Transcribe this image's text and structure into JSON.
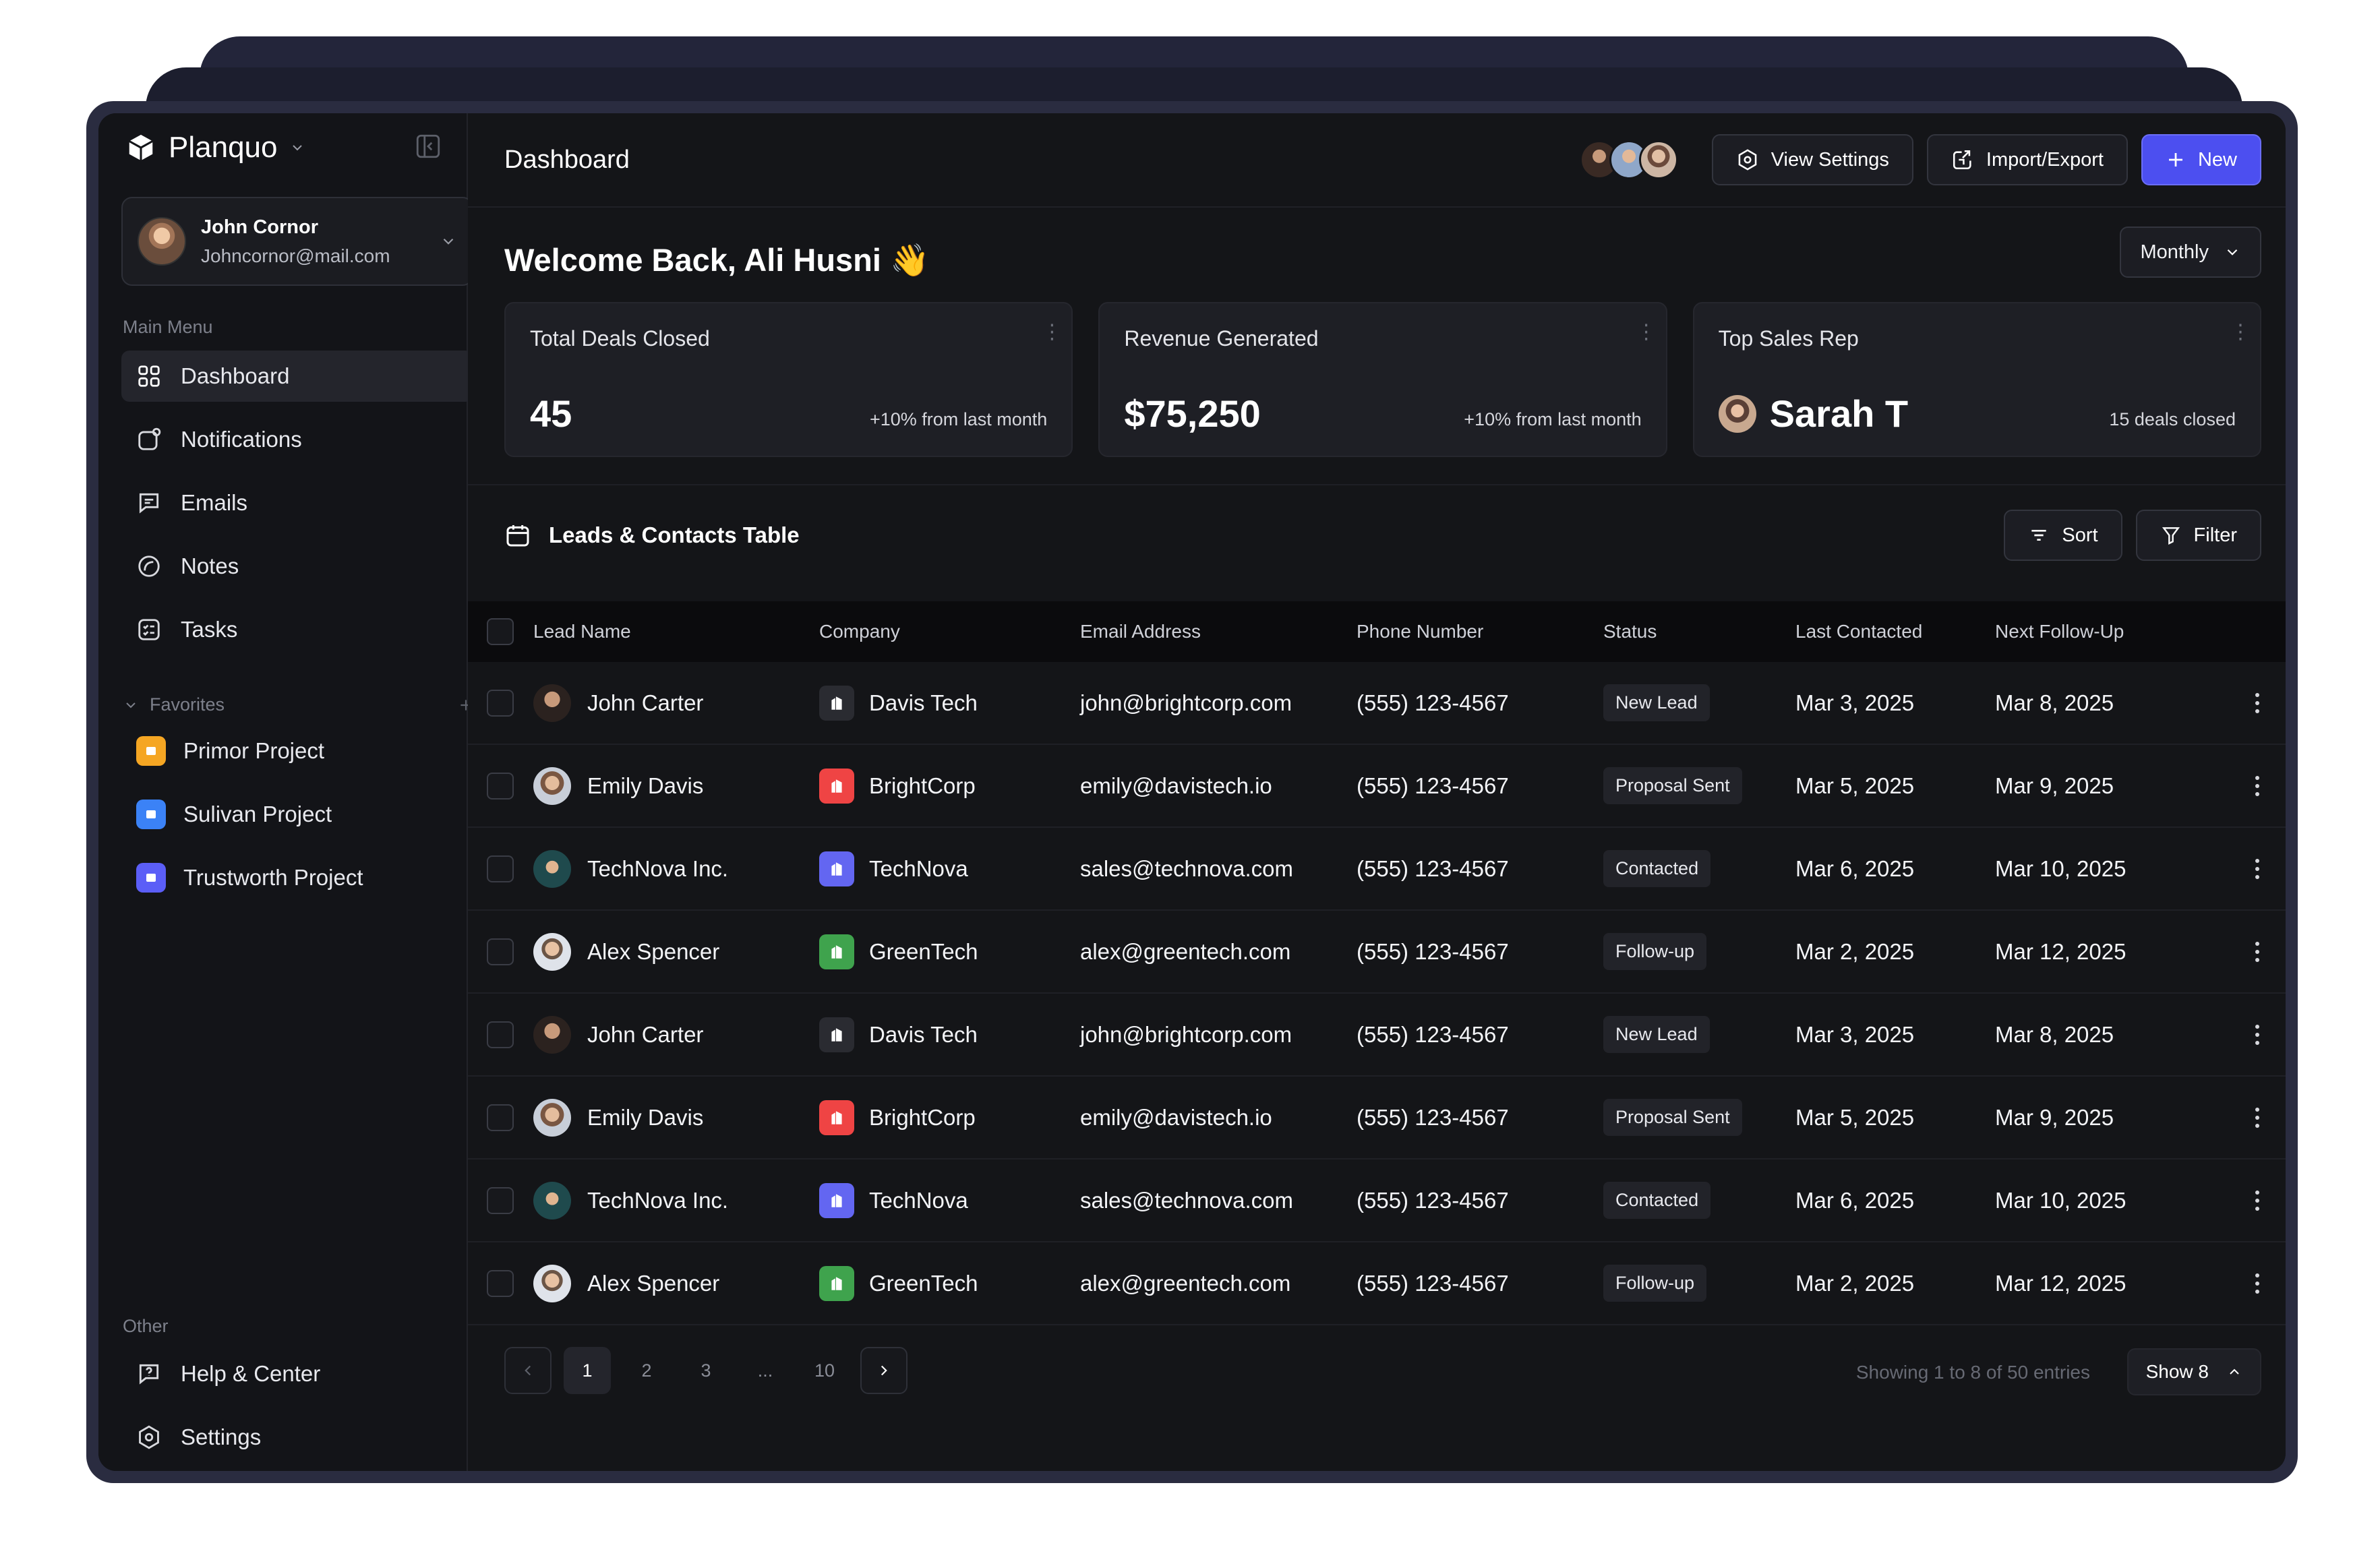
{
  "app": {
    "name": "Planquo"
  },
  "user": {
    "name": "John Cornor",
    "email": "Johncornor@mail.com"
  },
  "sidebar": {
    "main_label": "Main Menu",
    "items": [
      {
        "label": "Dashboard",
        "icon": "grid-icon",
        "active": true
      },
      {
        "label": "Notifications",
        "icon": "bell-icon"
      },
      {
        "label": "Emails",
        "icon": "message-icon"
      },
      {
        "label": "Notes",
        "icon": "note-icon"
      },
      {
        "label": "Tasks",
        "icon": "tasks-icon"
      }
    ],
    "favorites_label": "Favorites",
    "favorites": [
      {
        "label": "Primor Project",
        "color": "#f5a623"
      },
      {
        "label": "Sulivan Project",
        "color": "#3b82f6"
      },
      {
        "label": "Trustworth Project",
        "color": "#5b5ef7"
      }
    ],
    "other_label": "Other",
    "other": [
      {
        "label": "Help & Center",
        "icon": "help-icon"
      },
      {
        "label": "Settings",
        "icon": "settings-icon"
      }
    ]
  },
  "header": {
    "title": "Dashboard",
    "view_settings": "View Settings",
    "import_export": "Import/Export",
    "new": "New"
  },
  "welcome": "Welcome Back, Ali Husni 👋",
  "period": "Monthly",
  "cards": [
    {
      "title": "Total Deals Closed",
      "value": "45",
      "note": "+10% from last month"
    },
    {
      "title": "Revenue Generated",
      "value": "$75,250",
      "note": "+10% from last month"
    },
    {
      "title": "Top Sales Rep",
      "value": "Sarah T",
      "note": "15 deals closed"
    }
  ],
  "table": {
    "title": "Leads & Contacts Table",
    "sort": "Sort",
    "filter": "Filter",
    "columns": [
      "Lead Name",
      "Company",
      "Email Address",
      "Phone Number",
      "Status",
      "Last Contacted",
      "Next Follow-Up"
    ],
    "rows": [
      {
        "name": "John Carter",
        "company": "Davis Tech",
        "email": "john@brightcorp.com",
        "phone": "(555) 123-4567",
        "status": "New Lead",
        "last": "Mar 3, 2025",
        "next": "Mar 8, 2025"
      },
      {
        "name": "Emily Davis",
        "company": "BrightCorp",
        "email": "emily@davistech.io",
        "phone": "(555) 123-4567",
        "status": "Proposal Sent",
        "last": "Mar 5, 2025",
        "next": "Mar 9, 2025"
      },
      {
        "name": "TechNova Inc.",
        "company": "TechNova",
        "email": "sales@technova.com",
        "phone": "(555) 123-4567",
        "status": "Contacted",
        "last": "Mar 6, 2025",
        "next": "Mar 10, 2025"
      },
      {
        "name": "Alex Spencer",
        "company": "GreenTech",
        "email": "alex@greentech.com",
        "phone": "(555) 123-4567",
        "status": "Follow-up",
        "last": "Mar 2, 2025",
        "next": "Mar 12, 2025"
      },
      {
        "name": "John Carter",
        "company": "Davis Tech",
        "email": "john@brightcorp.com",
        "phone": "(555) 123-4567",
        "status": "New Lead",
        "last": "Mar 3, 2025",
        "next": "Mar 8, 2025"
      },
      {
        "name": "Emily Davis",
        "company": "BrightCorp",
        "email": "emily@davistech.io",
        "phone": "(555) 123-4567",
        "status": "Proposal Sent",
        "last": "Mar 5, 2025",
        "next": "Mar 9, 2025"
      },
      {
        "name": "TechNova Inc.",
        "company": "TechNova",
        "email": "sales@technova.com",
        "phone": "(555) 123-4567",
        "status": "Contacted",
        "last": "Mar 6, 2025",
        "next": "Mar 10, 2025"
      },
      {
        "name": "Alex Spencer",
        "company": "GreenTech",
        "email": "alex@greentech.com",
        "phone": "(555) 123-4567",
        "status": "Follow-up",
        "last": "Mar 2, 2025",
        "next": "Mar 12, 2025"
      }
    ]
  },
  "pagination": {
    "pages": [
      "1",
      "2",
      "3",
      "...",
      "10"
    ],
    "showing": "Showing 1 to 8 of 50 entries",
    "show": "Show 8"
  },
  "colors": {
    "accent": "#4c4ff0",
    "davis": "#2a2b31",
    "bright": "#ef4444",
    "technova": "#6366f1",
    "greentech": "#3fa34d"
  }
}
